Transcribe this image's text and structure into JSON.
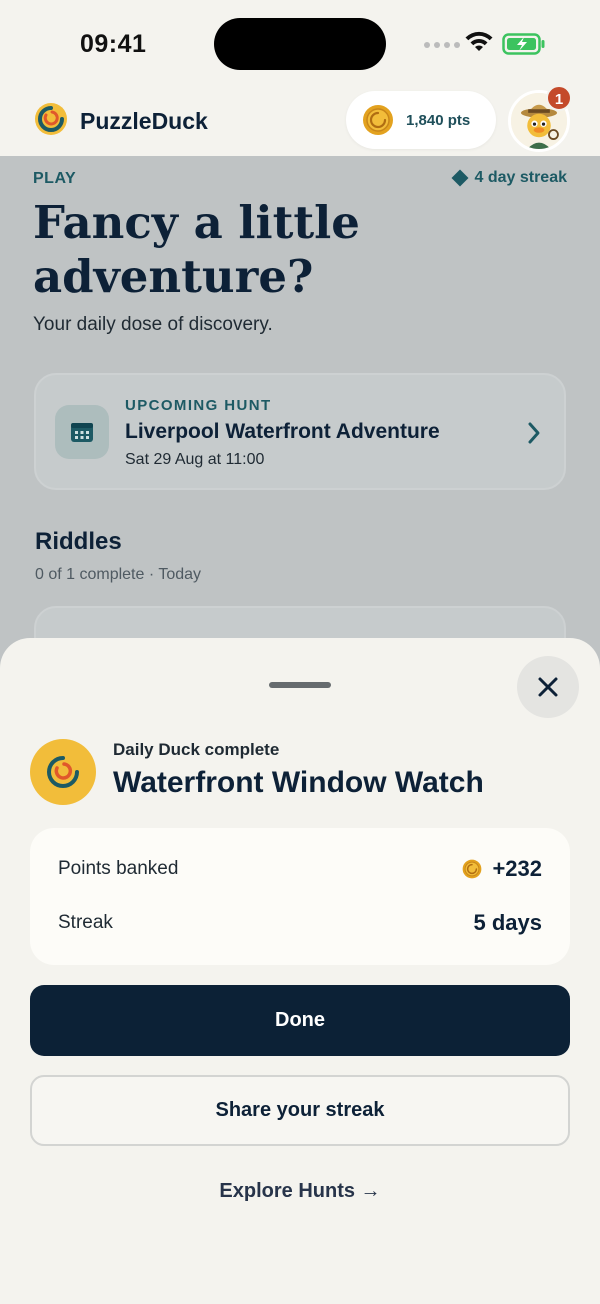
{
  "status_bar": {
    "time": "09:41"
  },
  "header": {
    "brand": "PuzzleDuck",
    "points": "1,840 pts",
    "notification_count": "1"
  },
  "main": {
    "section_label": "PLAY",
    "streak": "4 day streak",
    "hero_line1": "Fancy a little",
    "hero_line2": "adventure?",
    "hero_subtitle": "Your daily dose of discovery.",
    "upcoming": {
      "eyebrow": "UPCOMING HUNT",
      "title": "Liverpool Waterfront Adventure",
      "date": "Sat 29 Aug at 11:00"
    },
    "riddles": {
      "title": "Riddles",
      "subtitle": "0 of 1 complete · Today"
    }
  },
  "sheet": {
    "eyebrow": "Daily Duck complete",
    "title": "Waterfront Window Watch",
    "stats": [
      {
        "label": "Points banked",
        "value": "+232"
      },
      {
        "label": "Streak",
        "value": "5 days"
      }
    ],
    "done_label": "Done",
    "share_label": "Share your streak",
    "explore_label": "Explore Hunts →"
  },
  "colors": {
    "navy": "#0c2136",
    "teal": "#1d5a64",
    "gold": "#f2bd3a",
    "badge_red": "#c44a2a",
    "battery_green": "#3cc35f"
  },
  "icons": [
    "puzzleduck-logo-icon",
    "coin-icon",
    "calendar-icon",
    "chevron-right-icon",
    "close-icon",
    "wifi-icon",
    "battery-icon"
  ]
}
